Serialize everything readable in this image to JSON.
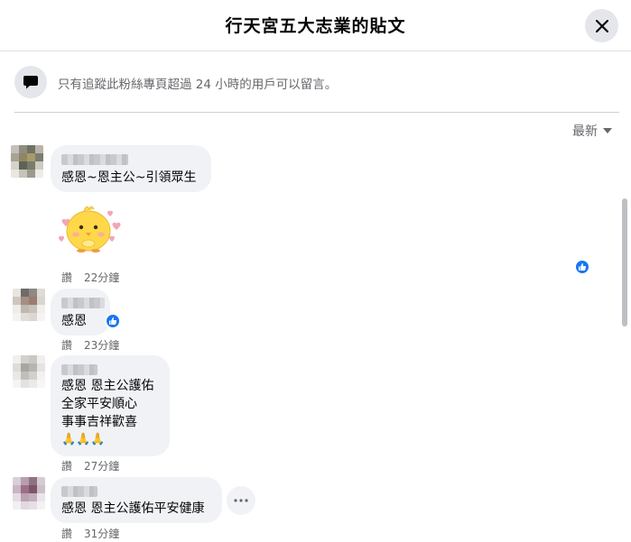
{
  "header": {
    "title": "行天宮五大志業的貼文"
  },
  "notice": {
    "text": "只有追蹤此粉絲專頁超過 24 小時的用戶可以留言。"
  },
  "sort": {
    "label": "最新"
  },
  "comments": [
    {
      "text": "感恩~恩主公~引領眾生",
      "like_label": "讚",
      "time": "22分鐘",
      "has_sticker": true
    },
    {
      "text": "感恩",
      "like_label": "讚",
      "time": "23分鐘"
    },
    {
      "lines": [
        "感恩 恩主公護佑",
        "全家平安順心",
        "事事吉祥歡喜",
        "🙏🙏🙏"
      ],
      "like_label": "讚",
      "time": "27分鐘"
    },
    {
      "text": "感恩 恩主公護佑平安健康",
      "like_label": "讚",
      "time": "31分鐘"
    }
  ],
  "colors": {
    "accent": "#1877f2",
    "bubble": "#f0f2f5",
    "muted": "#65676b"
  }
}
